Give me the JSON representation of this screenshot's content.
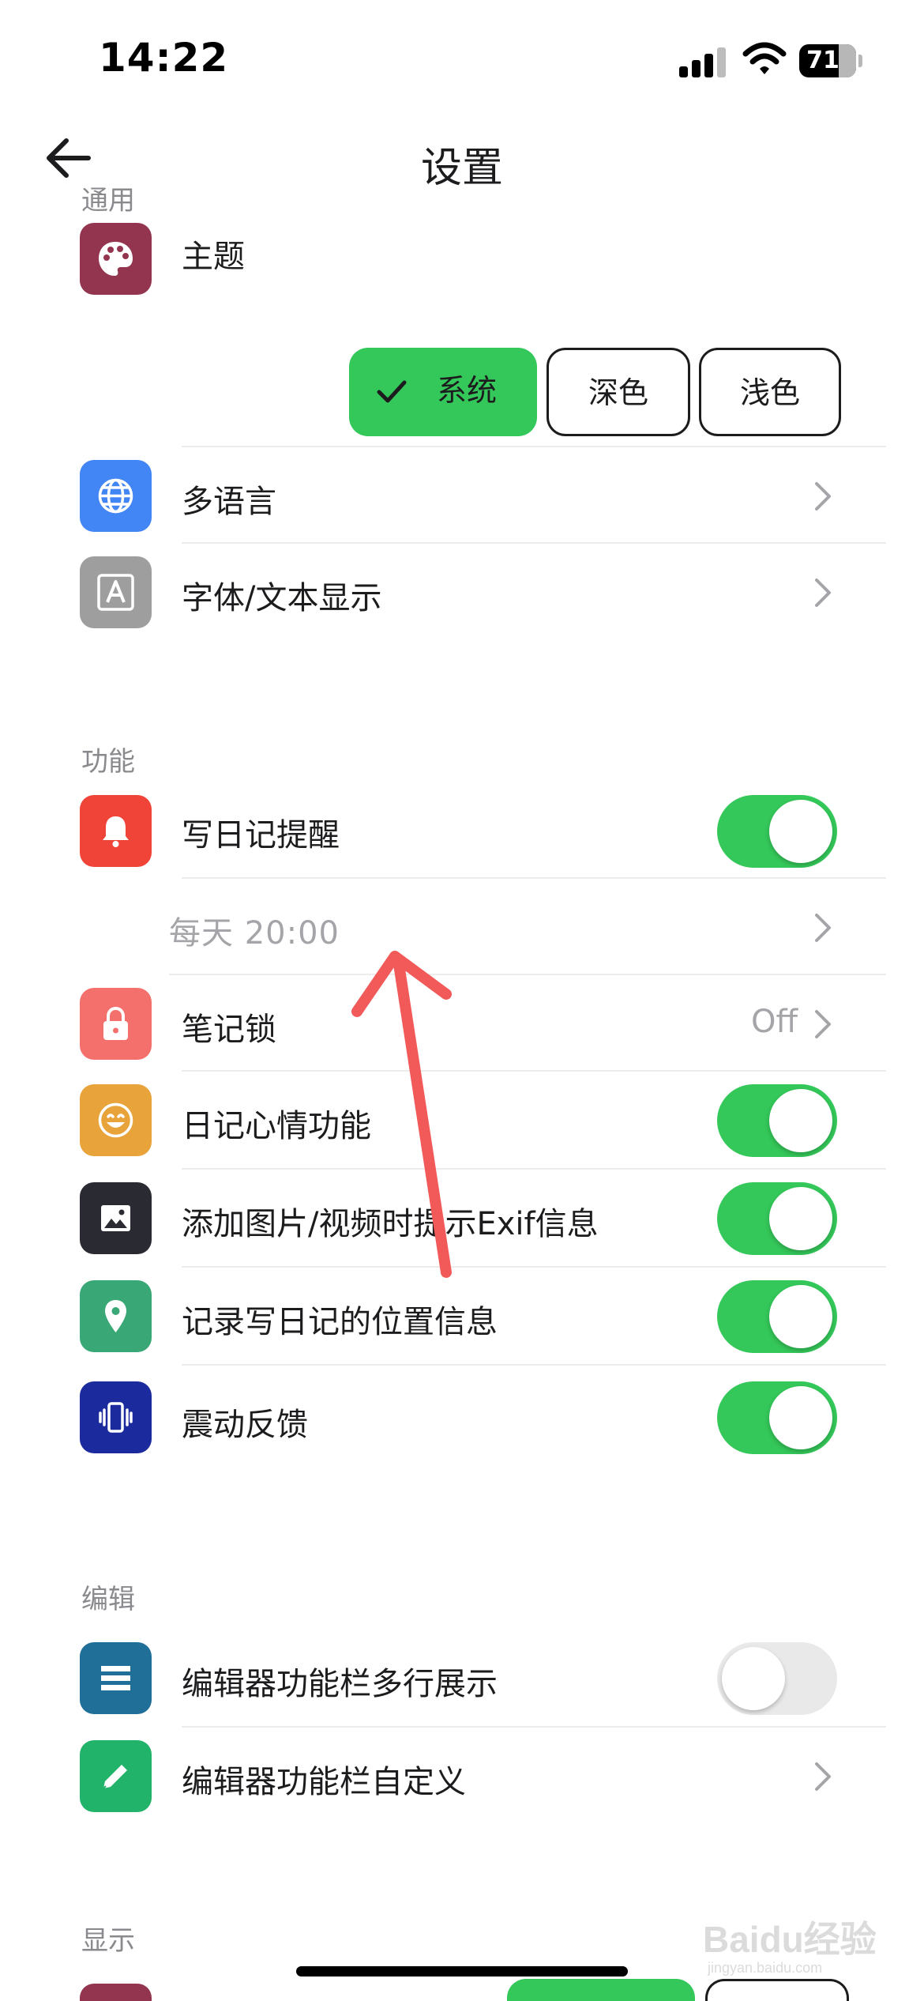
{
  "status_bar": {
    "time": "14:22",
    "battery_level": "71",
    "battery_fraction": 0.71
  },
  "nav": {
    "title": "设置",
    "back_icon": "arrow-left-icon"
  },
  "sections": {
    "general": {
      "header": "通用",
      "theme": {
        "label": "主题",
        "options": [
          "系统",
          "深色",
          "浅色"
        ],
        "selected": "系统"
      },
      "language": {
        "label": "多语言"
      },
      "font": {
        "label": "字体/文本显示"
      }
    },
    "features": {
      "header": "功能",
      "reminder": {
        "label": "写日记提醒",
        "enabled": true
      },
      "reminder_time": {
        "label": "每天 20:00"
      },
      "note_lock": {
        "label": "笔记锁",
        "value": "Off"
      },
      "mood": {
        "label": "日记心情功能",
        "enabled": true
      },
      "exif": {
        "label": "添加图片/视频时提示Exif信息",
        "enabled": true
      },
      "location": {
        "label": "记录写日记的位置信息",
        "enabled": true
      },
      "haptic": {
        "label": "震动反馈",
        "enabled": true
      }
    },
    "editor": {
      "header": "编辑",
      "multiline": {
        "label": "编辑器功能栏多行展示",
        "enabled": false
      },
      "customize": {
        "label": "编辑器功能栏自定义"
      }
    },
    "display": {
      "header": "显示"
    }
  },
  "colors": {
    "accent_green": "#34c759",
    "theme_icon": "#93354e",
    "language_icon": "#4285f4",
    "font_icon": "#9e9e9e",
    "reminder_icon": "#f04438",
    "lock_icon": "#f4706c",
    "mood_icon": "#e8a33a",
    "exif_icon": "#2a2a33",
    "location_icon": "#3aa876",
    "haptic_icon": "#1b2a9c",
    "multiline_icon": "#1f6f99",
    "customize_icon": "#22b36a",
    "annotation_arrow": "#f25a5a"
  },
  "watermark": {
    "text": "Baidu经验",
    "sub": "jingyan.baidu.com"
  }
}
